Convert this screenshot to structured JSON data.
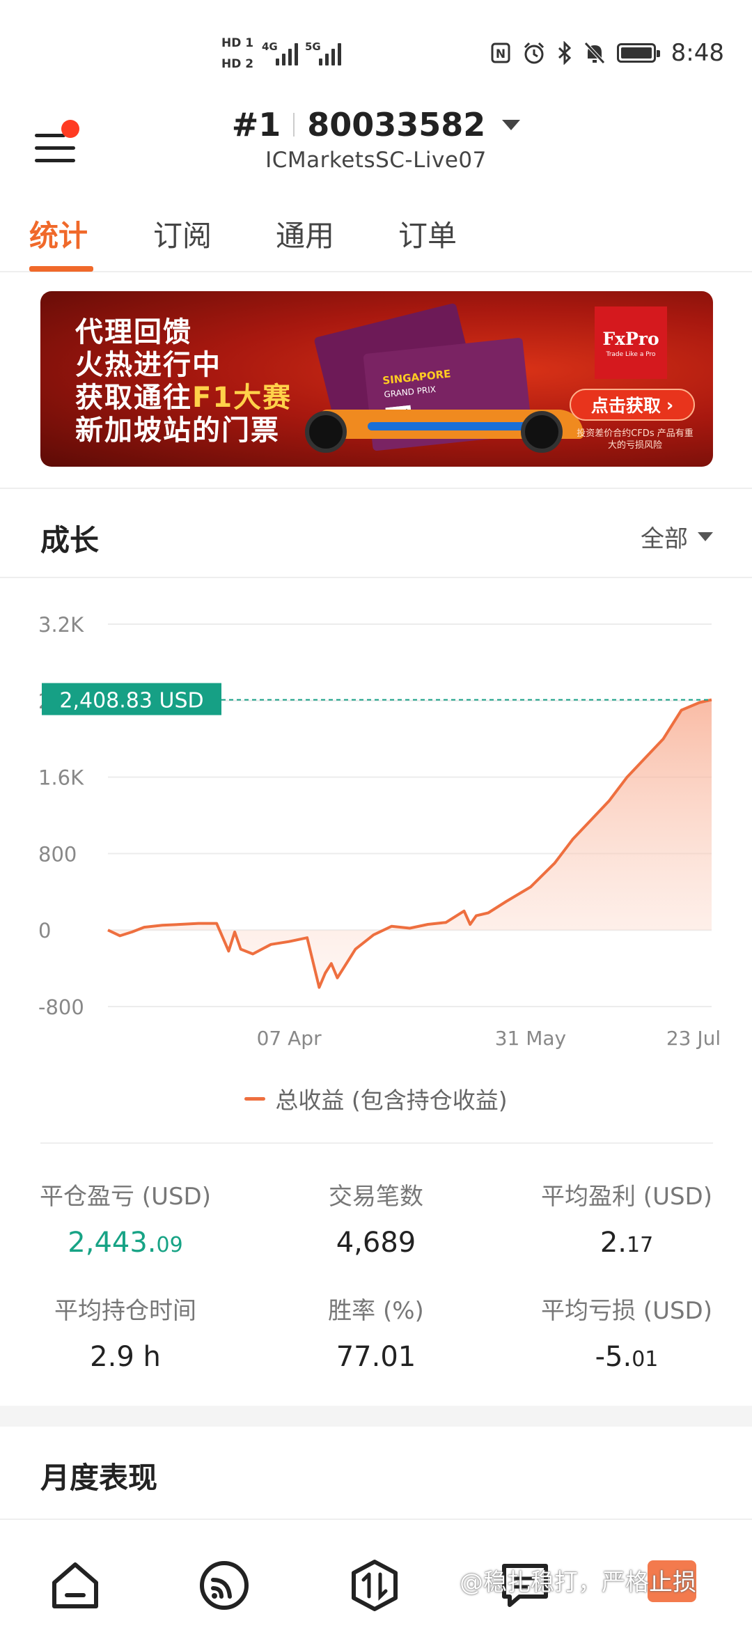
{
  "status_bar": {
    "sim1": "HD 1",
    "sim2": "HD 2",
    "net1": "4G",
    "net2": "5G",
    "time": "8:48",
    "icons": [
      "nfc-icon",
      "alarm-icon",
      "bluetooth-icon",
      "mute-icon",
      "battery-icon"
    ]
  },
  "header": {
    "rank": "#1",
    "account_number": "80033582",
    "server": "ICMarketsSC-Live07"
  },
  "tabs": [
    {
      "label": "统计",
      "active": true
    },
    {
      "label": "订阅",
      "active": false
    },
    {
      "label": "通用",
      "active": false
    },
    {
      "label": "订单",
      "active": false
    }
  ],
  "banner": {
    "lines": [
      "代理回馈",
      "火热进行中",
      "获取通往",
      "F1大赛",
      "新加坡站的门票"
    ],
    "ticket_title": "SINGAPORE",
    "ticket_sub": "GRAND PRIX",
    "brand": "FxPro",
    "brand_tag": "Trade Like a Pro",
    "cta": "点击获取",
    "risk": "投资差价合约CFDs 产品有重大的亏损风险"
  },
  "growth": {
    "title": "成长",
    "range": "全部",
    "current_value_label": "2,408.83 USD",
    "legend": "总收益 (包含持仓收益)"
  },
  "chart_data": {
    "type": "area",
    "title": "",
    "series": [
      {
        "name": "总收益 (包含持仓收益)",
        "color": "#ee6f3f",
        "x": [
          0,
          2,
          4,
          6,
          9,
          12,
          15,
          18,
          20,
          21,
          22,
          24,
          27,
          30,
          33,
          35,
          36,
          37,
          38,
          41,
          44,
          47,
          50,
          53,
          56,
          59,
          60,
          61,
          63,
          66,
          70,
          74,
          77,
          80,
          83,
          86,
          89,
          92,
          95,
          98,
          100
        ],
        "values": [
          0,
          -60,
          -20,
          30,
          50,
          60,
          70,
          70,
          -220,
          -20,
          -200,
          -250,
          -150,
          -120,
          -80,
          -600,
          -450,
          -350,
          -500,
          -200,
          -50,
          40,
          20,
          60,
          80,
          200,
          60,
          150,
          180,
          300,
          450,
          700,
          950,
          1150,
          1350,
          1600,
          1800,
          2000,
          2300,
          2380,
          2408.83
        ]
      }
    ],
    "x_tick_labels": [
      "07 Apr",
      "31 May",
      "23 Jul"
    ],
    "y_tick_labels": [
      "3.2K",
      "2.4K",
      "1.6K",
      "800",
      "0",
      "-800"
    ],
    "ylim": [
      -800,
      3200
    ],
    "reference_value": 2408.83,
    "reference_label": "2,408.83 USD",
    "grid": true
  },
  "stats": [
    {
      "label": "平仓盈亏 (USD)",
      "value_main": "2,443.",
      "value_small": "09",
      "green": true
    },
    {
      "label": "交易笔数",
      "value_main": "4,689",
      "value_small": "",
      "green": false
    },
    {
      "label": "平均盈利 (USD)",
      "value_main": "2.",
      "value_small": "17",
      "green": false
    },
    {
      "label": "平均持仓时间",
      "value_main": "2.9 h",
      "value_small": "",
      "green": false
    },
    {
      "label": "胜率 (%)",
      "value_main": "77.01",
      "value_small": "",
      "green": false
    },
    {
      "label": "平均亏损 (USD)",
      "value_main": "-5.",
      "value_small": "01",
      "green": false
    }
  ],
  "monthly": {
    "title": "月度表现"
  },
  "bottom_nav": [
    "home-icon",
    "signal-icon",
    "trade-icon",
    "chat-icon",
    "more-icon"
  ],
  "watermark": "@稳扎稳打，严格止损"
}
